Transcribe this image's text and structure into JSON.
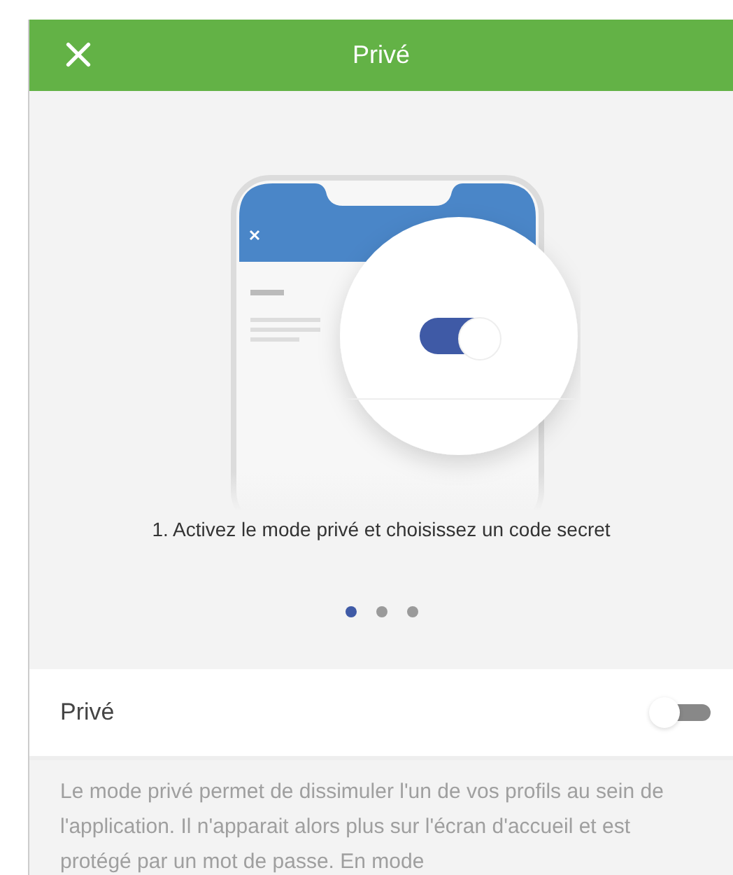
{
  "header": {
    "title": "Privé"
  },
  "carousel": {
    "caption": "1. Activez le mode privé et choisissez un code secret",
    "dots": [
      {
        "selected": true
      },
      {
        "selected": false
      },
      {
        "selected": false
      }
    ]
  },
  "setting": {
    "label": "Privé",
    "on": false
  },
  "description": "Le mode privé permet de dissimuler l'un de vos profils au sein de l'application. Il n'apparait alors plus sur l'écran d'accueil et est protégé par un mot de passe. En mode"
}
